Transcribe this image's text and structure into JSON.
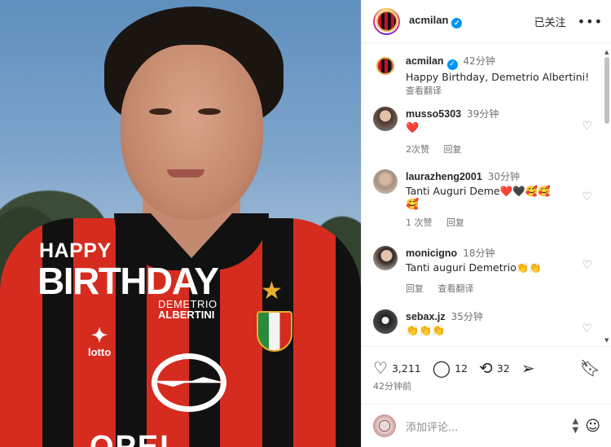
{
  "image": {
    "happy": "HAPPY",
    "birthday": "BIRTHDAY",
    "first_name": "DEMETRIO",
    "last_name": "ALBERTINI",
    "kit_brand": "lotto",
    "sponsor": "OPEL"
  },
  "header": {
    "username": "acmilan",
    "follow_label": "已关注",
    "more_icon": "more-horizontal-icon"
  },
  "caption": {
    "username": "acmilan",
    "time": "42分钟",
    "text": "Happy Birthday, Demetrio Albertini!",
    "translate": "查看翻译"
  },
  "comments": [
    {
      "username": "musso5303",
      "time": "39分钟",
      "text": "❤️",
      "likes": "2次赞",
      "reply": "回复",
      "translate": ""
    },
    {
      "username": "laurazheng2001",
      "time": "30分钟",
      "text": "Tanti Auguri Deme❤️🖤🥰🥰",
      "text2": "🥰",
      "likes": "1 次赞",
      "reply": "回复",
      "translate": ""
    },
    {
      "username": "monicigno",
      "time": "18分钟",
      "text": "Tanti auguri Demetrio👏👏",
      "likes": "",
      "reply": "回复",
      "translate": "查看翻译"
    },
    {
      "username": "sebax.jz",
      "time": "35分钟",
      "text": "👏👏👏",
      "likes": "",
      "reply": "",
      "translate": ""
    }
  ],
  "actions": {
    "likes": "3,211",
    "comments": "12",
    "reposts": "32",
    "posted_ago": "42分钟前"
  },
  "add_comment": {
    "placeholder": "添加评论..."
  },
  "colors": {
    "verified": "#0095f6",
    "milan_red": "#d62b1f",
    "heart_red": "#e0245e"
  }
}
